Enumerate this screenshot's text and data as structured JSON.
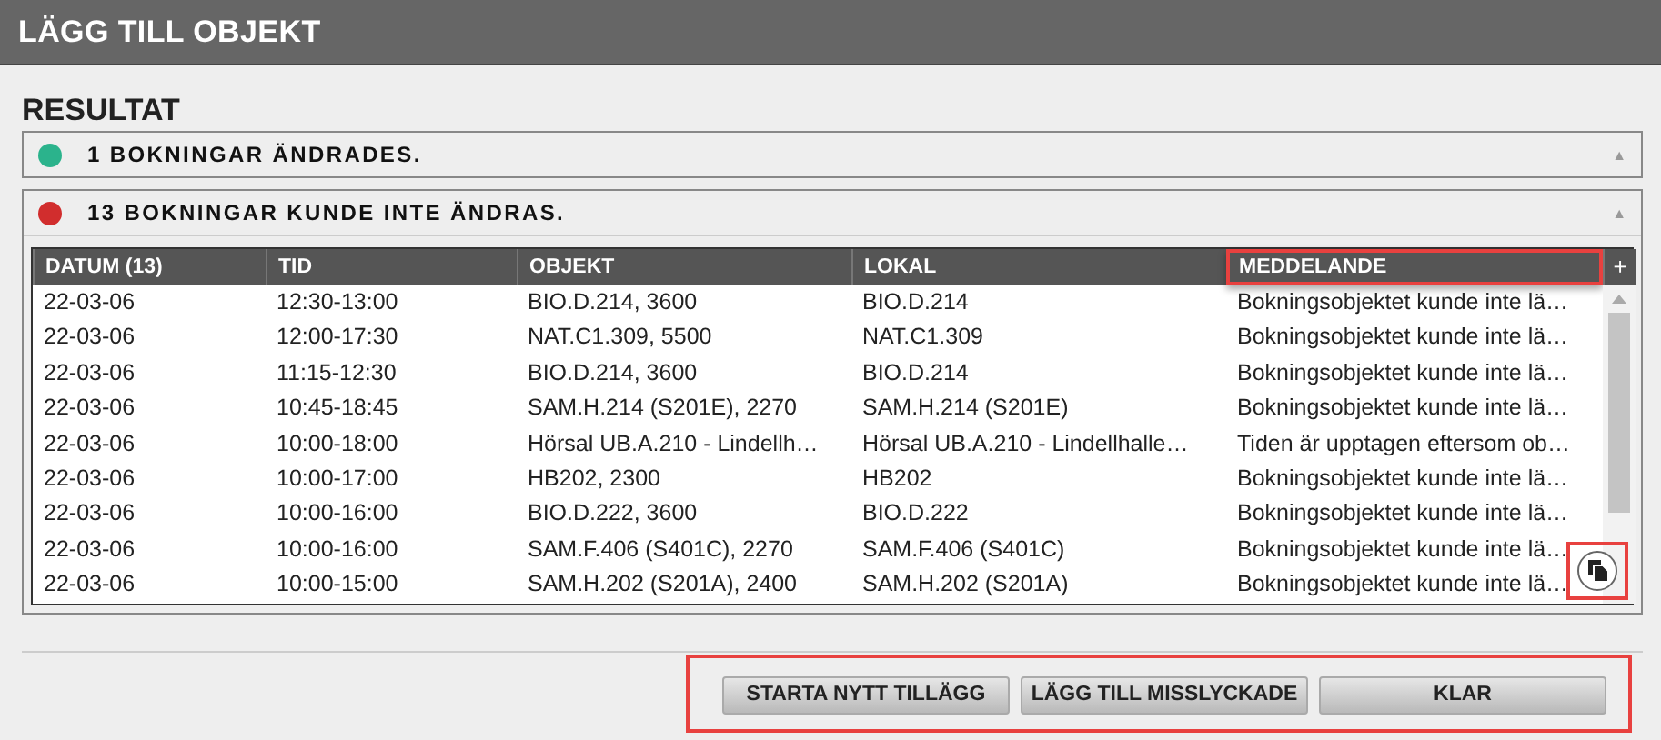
{
  "window": {
    "title": "LÄGG TILL OBJEKT"
  },
  "result": {
    "heading": "RESULTAT",
    "sections": [
      {
        "color": "#2bb38c",
        "label": "1 BOKNINGAR ÄNDRADES.",
        "expanded": false,
        "collapse_icon": "▲"
      },
      {
        "color": "#d12d2d",
        "label": "13 BOKNINGAR KUNDE INTE ÄNDRAS.",
        "expanded": true,
        "collapse_icon": "▲"
      }
    ]
  },
  "table": {
    "columns": [
      {
        "label": "DATUM (13)",
        "highlighted": false
      },
      {
        "label": "TID",
        "highlighted": false
      },
      {
        "label": "OBJEKT",
        "highlighted": false
      },
      {
        "label": "LOKAL",
        "highlighted": false
      },
      {
        "label": "MEDDELANDE",
        "highlighted": true
      }
    ],
    "add_column": "+",
    "rows": [
      [
        "22-03-06",
        "12:30-13:00",
        "BIO.D.214, 3600",
        "BIO.D.214",
        "Bokningsobjektet kunde inte lä…"
      ],
      [
        "22-03-06",
        "12:00-17:30",
        "NAT.C1.309, 5500",
        "NAT.C1.309",
        "Bokningsobjektet kunde inte lä…"
      ],
      [
        "22-03-06",
        "11:15-12:30",
        "BIO.D.214, 3600",
        "BIO.D.214",
        "Bokningsobjektet kunde inte lä…"
      ],
      [
        "22-03-06",
        "10:45-18:45",
        "SAM.H.214 (S201E), 2270",
        "SAM.H.214 (S201E)",
        "Bokningsobjektet kunde inte lä…"
      ],
      [
        "22-03-06",
        "10:00-18:00",
        "Hörsal UB.A.210 - Lindellh…",
        "Hörsal UB.A.210 - Lindellhalle…",
        "Tiden är upptagen eftersom ob…"
      ],
      [
        "22-03-06",
        "10:00-17:00",
        "HB202, 2300",
        "HB202",
        "Bokningsobjektet kunde inte lä…"
      ],
      [
        "22-03-06",
        "10:00-16:00",
        "BIO.D.222, 3600",
        "BIO.D.222",
        "Bokningsobjektet kunde inte lä…"
      ],
      [
        "22-03-06",
        "10:00-16:00",
        "SAM.F.406 (S401C), 2270",
        "SAM.F.406 (S401C)",
        "Bokningsobjektet kunde inte lä…"
      ],
      [
        "22-03-06",
        "10:00-15:00",
        "SAM.H.202 (S201A), 2400",
        "SAM.H.202 (S201A)",
        "Bokningsobjektet kunde inte lä…"
      ]
    ],
    "copy_button": {
      "highlighted": true
    }
  },
  "buttons": {
    "highlighted": true,
    "items": [
      "STARTA NYTT TILLÄGG",
      "LÄGG TILL MISSLYCKADE",
      "KLAR"
    ]
  }
}
